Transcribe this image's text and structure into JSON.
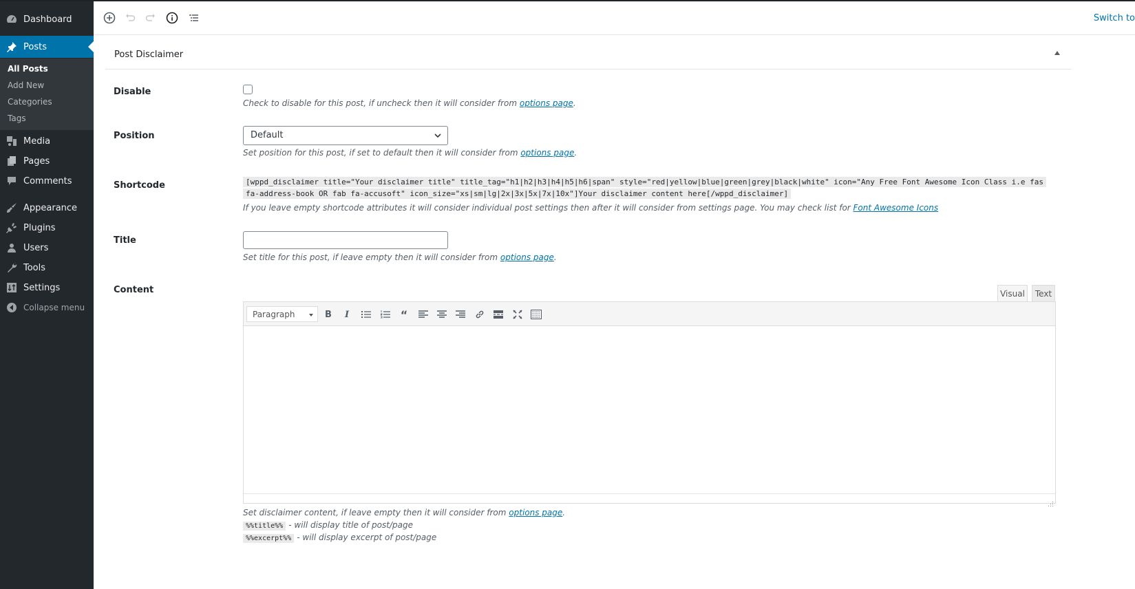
{
  "sidebar": {
    "items": [
      {
        "label": "Dashboard",
        "icon": "dashboard-icon"
      },
      {
        "label": "Posts",
        "icon": "pushpin-icon",
        "active": true
      },
      {
        "label": "Media",
        "icon": "media-icon"
      },
      {
        "label": "Pages",
        "icon": "pages-icon"
      },
      {
        "label": "Comments",
        "icon": "comments-icon"
      },
      {
        "label": "Appearance",
        "icon": "paintbrush-icon"
      },
      {
        "label": "Plugins",
        "icon": "plugin-icon"
      },
      {
        "label": "Users",
        "icon": "users-icon"
      },
      {
        "label": "Tools",
        "icon": "wrench-icon"
      },
      {
        "label": "Settings",
        "icon": "settings-icon"
      }
    ],
    "submenu": [
      "All Posts",
      "Add New",
      "Categories",
      "Tags"
    ],
    "collapse_label": "Collapse menu"
  },
  "toolbar": {
    "buttons": [
      "add-block",
      "undo",
      "redo",
      "info",
      "outline"
    ],
    "switch_label": "Switch to"
  },
  "metabox": {
    "title": "Post Disclaimer",
    "fields": {
      "disable": {
        "label": "Disable",
        "checked": false,
        "desc": "Check to disable for this post, if uncheck then it will consider from ",
        "link": "options page"
      },
      "position": {
        "label": "Position",
        "value": "Default",
        "desc": "Set position for this post, if set to default then it will consider from ",
        "link": "options page"
      },
      "shortcode": {
        "label": "Shortcode",
        "line1": "[wppd_disclaimer title=\"Your disclaimer title\" title_tag=\"h1|h2|h3|h4|h5|h6|span\" style=\"red|yellow|blue|green|grey|black|white\" icon=\"Any Free Font Awesome Icon Class i.e fas",
        "line2": "fa-address-book OR fab fa-accusoft\" icon_size=\"xs|sm|lg|2x|3x|5x|7x|10x\"]Your disclaimer content here[/wppd_disclaimer]",
        "desc": "If you leave empty shortcode attributes it will consider individual post settings then after it will consider from settings page. You may check list for ",
        "link": "Font Awesome Icons"
      },
      "title": {
        "label": "Title",
        "value": "",
        "desc": "Set title for this post, if leave empty then it will consider from ",
        "link": "options page"
      },
      "content": {
        "label": "Content",
        "tabs": [
          "Visual",
          "Text"
        ],
        "format": "Paragraph",
        "desc": "Set disclaimer content, if leave empty then it will consider from ",
        "link": "options page",
        "tags": [
          {
            "code": "%%title%%",
            "text": "- will display title of post/page"
          },
          {
            "code": "%%excerpt%%",
            "text": "- will display excerpt of post/page"
          }
        ]
      }
    }
  }
}
